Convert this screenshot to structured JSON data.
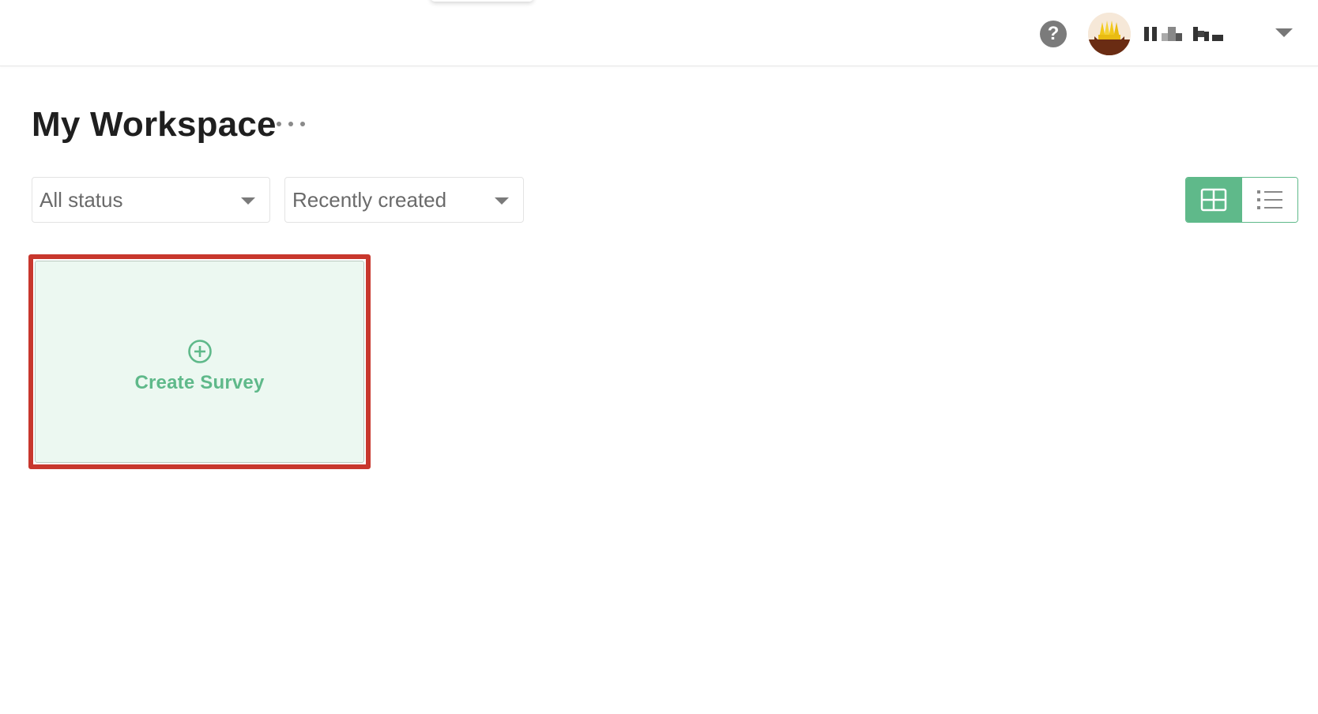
{
  "header": {
    "help_icon": "question-circle-icon",
    "help_glyph": "?",
    "user": {
      "avatar_icon": "user-avatar",
      "name_display": "pixelated-name",
      "menu_icon": "chevron-down-icon"
    }
  },
  "workspace": {
    "title": "My Workspace",
    "more_icon": "ellipsis-icon"
  },
  "filters": {
    "status": {
      "selected": "All status",
      "icon": "caret-down-icon"
    },
    "sort": {
      "selected": "Recently created",
      "icon": "caret-down-icon"
    }
  },
  "view_toggle": {
    "active": "grid",
    "grid_icon": "grid-view-icon",
    "list_icon": "list-view-icon"
  },
  "cards": {
    "create": {
      "label": "Create Survey",
      "icon": "plus-circle-icon"
    }
  },
  "colors": {
    "accent": "#5fb98a",
    "card_bg": "#ecf8f1",
    "highlight": "#c8372d"
  }
}
